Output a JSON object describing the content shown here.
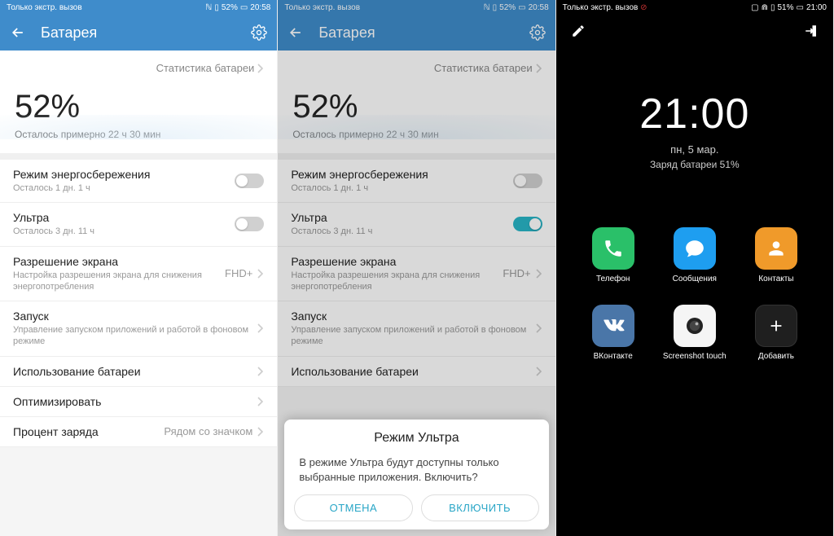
{
  "status": {
    "carrier": "Только экстр. вызов",
    "battery_pct_12": "52%",
    "time_12": "20:58",
    "battery_pct_3": "51%",
    "time_3": "21:00"
  },
  "title": "Батарея",
  "stats_link": "Статистика батареи",
  "percent": {
    "value": "52%",
    "remaining": "Осталось примерно 22 ч 30 мин"
  },
  "rows": {
    "power_save": {
      "title": "Режим энергосбережения",
      "sub": "Осталось 1 дн. 1 ч"
    },
    "ultra": {
      "title": "Ультра",
      "sub": "Осталось 3 дн. 11 ч"
    },
    "resolution": {
      "title": "Разрешение экрана",
      "sub": "Настройка разрешения экрана для снижения энергопотребления",
      "value": "FHD+"
    },
    "launch": {
      "title": "Запуск",
      "sub": "Управление запуском приложений и работой в фоновом режиме"
    },
    "usage": {
      "title": "Использование батареи"
    },
    "optimize": {
      "title": "Оптимизировать"
    },
    "percent_row": {
      "title": "Процент заряда",
      "value": "Рядом со значком"
    }
  },
  "modal": {
    "title": "Режим Ультра",
    "body": "В режиме Ультра будут доступны только выбранные приложения. Включить?",
    "cancel": "ОТМЕНА",
    "confirm": "ВКЛЮЧИТЬ"
  },
  "lock": {
    "clock": "21:00",
    "date": "пн, 5 мар.",
    "battery": "Заряд батареи 51%"
  },
  "apps": {
    "phone": "Телефон",
    "messages": "Сообщения",
    "contacts": "Контакты",
    "vk": "ВКонтакте",
    "screenshot": "Screenshot touch",
    "add": "Добавить"
  }
}
